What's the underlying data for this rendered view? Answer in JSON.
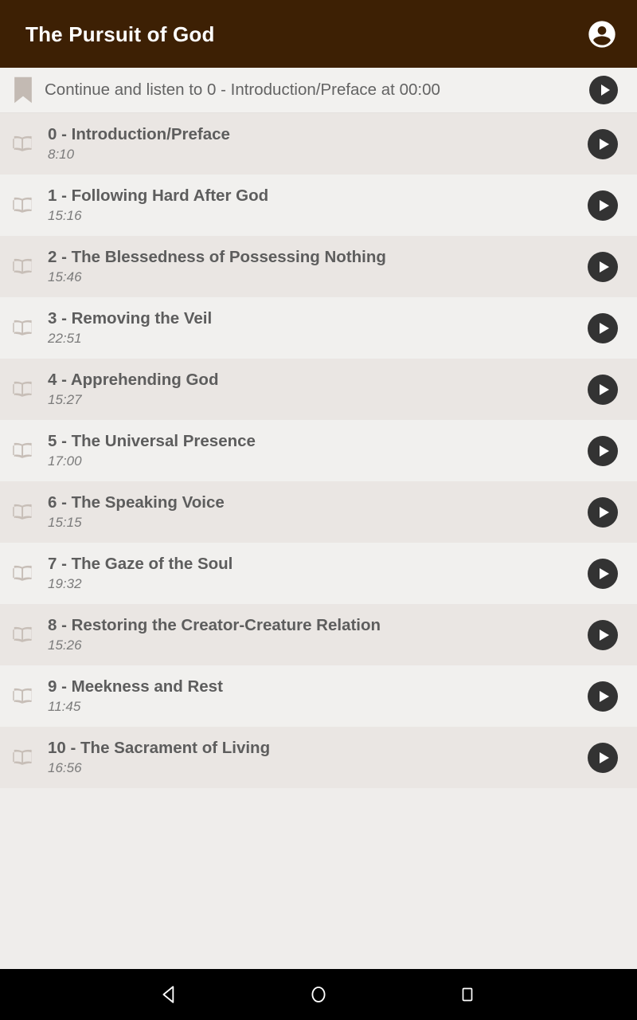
{
  "appbar": {
    "title": "The Pursuit of God",
    "account_icon": "account-circle-icon",
    "background": "#3d2004",
    "title_color": "#ffffff"
  },
  "continue_bar": {
    "bookmark_icon": "bookmark-icon",
    "text": "Continue and listen to 0 - Introduction/Preface at 00:00",
    "play_icon": "play-icon",
    "background": "#f2f1ef"
  },
  "list": {
    "item_icon": "open-book-icon",
    "play_icon": "play-icon",
    "row_colors": [
      "#eae6e3",
      "#f1f0ee"
    ],
    "items": [
      {
        "title": "0 - Introduction/Preface",
        "duration": "8:10"
      },
      {
        "title": "1 - Following Hard After God",
        "duration": "15:16"
      },
      {
        "title": "2 - The Blessedness of Possessing Nothing",
        "duration": "15:46"
      },
      {
        "title": "3 - Removing the Veil",
        "duration": "22:51"
      },
      {
        "title": "4 - Apprehending God",
        "duration": "15:27"
      },
      {
        "title": "5 - The Universal Presence",
        "duration": "17:00"
      },
      {
        "title": "6 - The Speaking Voice",
        "duration": "15:15"
      },
      {
        "title": "7 - The Gaze of the Soul",
        "duration": "19:32"
      },
      {
        "title": "8 - Restoring the Creator-Creature Relation",
        "duration": "15:26"
      },
      {
        "title": "9 - Meekness and Rest",
        "duration": "11:45"
      },
      {
        "title": "10 - The Sacrament of Living",
        "duration": "16:56"
      }
    ]
  },
  "navbar": {
    "back": "back-triangle-icon",
    "home": "home-circle-icon",
    "recents": "recents-square-icon",
    "background": "#000000"
  }
}
